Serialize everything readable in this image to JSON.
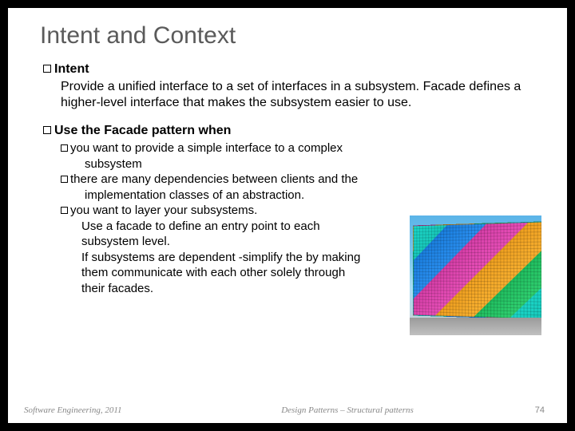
{
  "title": "Intent and Context",
  "section1": {
    "head": "Intent",
    "body": "Provide a unified interface to a set of interfaces in a subsystem. Facade defines a higher-level interface that makes the subsystem easier to use."
  },
  "section2": {
    "head": "Use the Facade pattern when",
    "items": [
      {
        "line1": "you want to provide a simple interface to a  complex",
        "cont": "subsystem"
      },
      {
        "line1": "there are many dependencies between clients and the",
        "cont": "implementation classes of an abstraction."
      },
      {
        "line1": "you want to layer your subsystems."
      }
    ],
    "extra": [
      "Use a facade to define an entry point to each",
      "subsystem level.",
      "If subsystems are dependent -simplify the by making",
      "them communicate with each other solely through",
      "their facades."
    ]
  },
  "footer": {
    "left": "Software Engineering, 2011",
    "center": "Design Patterns – Structural patterns",
    "right": "74"
  }
}
